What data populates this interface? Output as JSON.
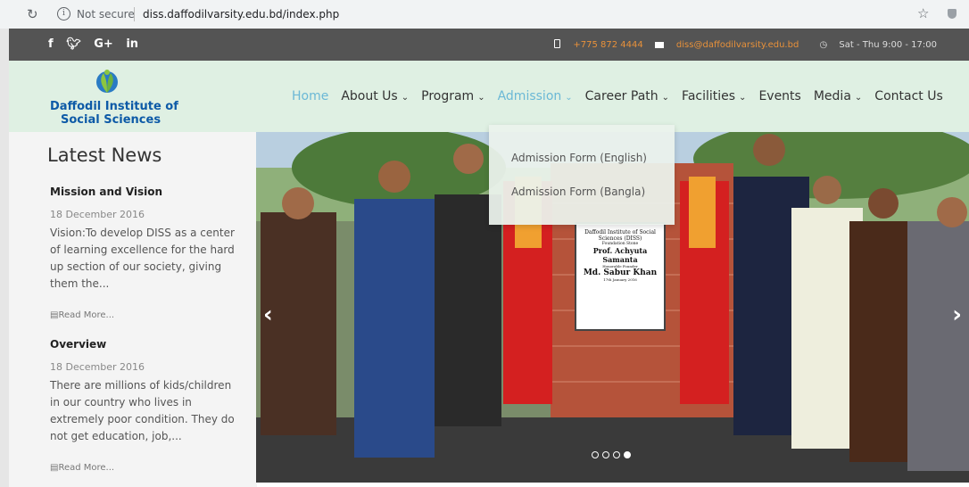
{
  "browser": {
    "security_label": "Not secure",
    "url": "diss.daffodilvarsity.edu.bd/index.php"
  },
  "topbar": {
    "social": [
      "f",
      " ",
      "G+",
      "in"
    ],
    "phone": "+775 872 4444",
    "email": "diss@daffodilvarsity.edu.bd",
    "hours": "Sat - Thu 9:00 - 17:00"
  },
  "logo": {
    "line1": "Daffodil Institute of",
    "line2": "Social Sciences"
  },
  "menu": {
    "home": "Home",
    "about": "About Us",
    "program": "Program",
    "admission": "Admission",
    "career": "Career Path",
    "facilities": "Facilities",
    "events": "Events",
    "media": "Media",
    "contact": "Contact Us"
  },
  "dropdown": {
    "opt1": "Admission Form (English)",
    "opt2": "Admission Form (Bangla)"
  },
  "news": {
    "heading": "Latest News",
    "items": [
      {
        "title": "Mission and Vision",
        "date": "18 December 2016",
        "body": "Vision:To develop DISS as a center of learning excellence for the hard up section of our society, giving them the...",
        "more": "Read More..."
      },
      {
        "title": "Overview",
        "date": "18 December 2016",
        "body": "There are millions of kids/children in our country who lives in extremely poor condition. They do not get education, job,...",
        "more": "Read More..."
      }
    ]
  },
  "slider": {
    "plaque": {
      "l1": "Daffodil Institute of Social Sciences (DISS)",
      "l2": "Foundation Stone",
      "l3": "Prof. Achyuta Samanta",
      "l4": "Honorable Founder",
      "l5": "Md. Sabur Khan",
      "l6": "17th January 2016"
    },
    "slides": 4,
    "active_slide": 4
  }
}
